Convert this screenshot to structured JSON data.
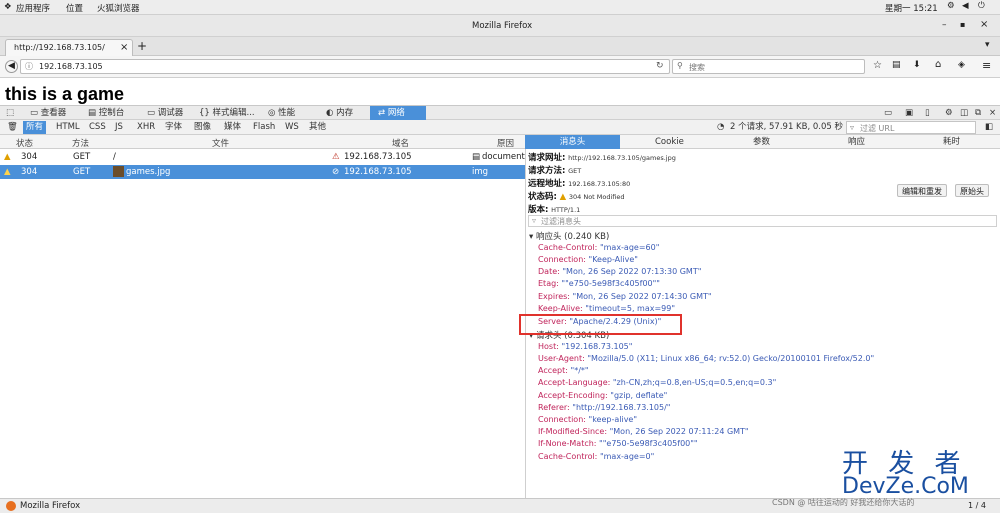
{
  "gnome": {
    "apps": "应用程序",
    "places": "位置",
    "browser": "火狐浏览器",
    "clock": "星期一 15:21"
  },
  "window": {
    "title": "Mozilla Firefox"
  },
  "tab": {
    "title": "http://192.168.73.105/",
    "close": "×",
    "new": "+"
  },
  "nav": {
    "url": "192.168.73.105",
    "search_placeholder": "搜索"
  },
  "page": {
    "heading": "this is a game"
  },
  "devtools": {
    "tabs": [
      "查看器",
      "控制台",
      "调试器",
      "样式编辑...",
      "性能",
      "内存",
      "网络"
    ],
    "filters": [
      "所有",
      "HTML",
      "CSS",
      "JS",
      "XHR",
      "字体",
      "图像",
      "媒体",
      "Flash",
      "WS",
      "其他"
    ],
    "summary": "2 个请求, 57.91 KB, 0.05 秒",
    "filter_url_placeholder": "过滤 URL"
  },
  "requests": {
    "columns": [
      "状态",
      "方法",
      "文件",
      "域名",
      "原因"
    ],
    "rows": [
      {
        "status": "304",
        "method": "GET",
        "file": "/",
        "domain": "192.168.73.105",
        "type": "document"
      },
      {
        "status": "304",
        "method": "GET",
        "file": "games.jpg",
        "domain": "192.168.73.105",
        "type": "img"
      }
    ]
  },
  "detail": {
    "tabs": [
      "消息头",
      "Cookie",
      "参数",
      "响应",
      "耗时"
    ],
    "request_url_label": "请求网址:",
    "request_url": "http://192.168.73.105/games.jpg",
    "request_method_label": "请求方法:",
    "request_method": "GET",
    "remote_addr_label": "远程地址:",
    "remote_addr": "192.168.73.105:80",
    "status_label": "状态码:",
    "status": "304 Not Modified",
    "version_label": "版本:",
    "version": "HTTP/1.1",
    "edit_resend": "编辑和重发",
    "raw_headers": "原始头",
    "filter_headers_placeholder": "过滤消息头",
    "response_section": "响应头 (0.240 KB)",
    "response_headers": [
      {
        "key": "Cache-Control:",
        "value": "\"max-age=60\""
      },
      {
        "key": "Connection:",
        "value": "\"Keep-Alive\""
      },
      {
        "key": "Date:",
        "value": "\"Mon, 26 Sep 2022 07:13:30 GMT\""
      },
      {
        "key": "Etag:",
        "value": "\"\"e750-5e98f3c405f00\"\""
      },
      {
        "key": "Expires:",
        "value": "\"Mon, 26 Sep 2022 07:14:30 GMT\""
      },
      {
        "key": "Keep-Alive:",
        "value": "\"timeout=5, max=99\""
      },
      {
        "key": "Server:",
        "value": "\"Apache/2.4.29 (Unix)\""
      }
    ],
    "request_section": "请求头 (0.304 KB)",
    "request_headers": [
      {
        "key": "Host:",
        "value": "\"192.168.73.105\""
      },
      {
        "key": "User-Agent:",
        "value": "\"Mozilla/5.0 (X11; Linux x86_64; rv:52.0) Gecko/20100101 Firefox/52.0\""
      },
      {
        "key": "Accept:",
        "value": "\"*/*\""
      },
      {
        "key": "Accept-Language:",
        "value": "\"zh-CN,zh;q=0.8,en-US;q=0.5,en;q=0.3\""
      },
      {
        "key": "Accept-Encoding:",
        "value": "\"gzip, deflate\""
      },
      {
        "key": "Referer:",
        "value": "\"http://192.168.73.105/\""
      },
      {
        "key": "Connection:",
        "value": "\"keep-alive\""
      },
      {
        "key": "If-Modified-Since:",
        "value": "\"Mon, 26 Sep 2022 07:11:24 GMT\""
      },
      {
        "key": "If-None-Match:",
        "value": "\"\"e750-5e98f3c405f00\"\""
      },
      {
        "key": "Cache-Control:",
        "value": "\"max-age=0\""
      }
    ]
  },
  "taskbar": {
    "window": "Mozilla Firefox",
    "pager": "1 / 4"
  },
  "watermark": {
    "big": "开 发 者",
    "big2": "DevZe.CoM",
    "small": "CSDN @ 咕往运动的 好我还给你大话的"
  },
  "colors": {
    "accent": "#4a90d9",
    "highlight": "#e0322c",
    "header_key": "#c0245b",
    "header_value": "#3b5bb5"
  }
}
